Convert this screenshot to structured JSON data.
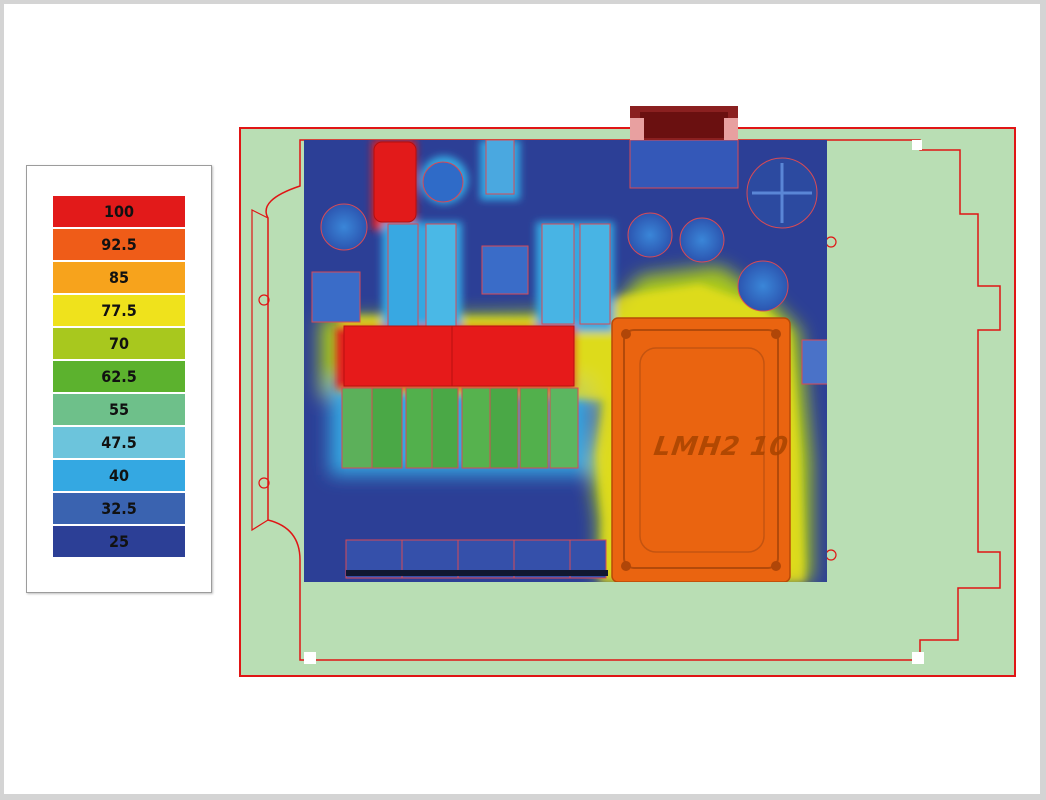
{
  "legend": {
    "entries": [
      {
        "label": "100",
        "color": "#e21a1a"
      },
      {
        "label": "92.5",
        "color": "#ef5c18"
      },
      {
        "label": "85",
        "color": "#f7a31c"
      },
      {
        "label": "77.5",
        "color": "#efe21c"
      },
      {
        "label": "70",
        "color": "#a8c81e"
      },
      {
        "label": "62.5",
        "color": "#5cb22e"
      },
      {
        "label": "55",
        "color": "#6ec08a"
      },
      {
        "label": "47.5",
        "color": "#6cc4dc"
      },
      {
        "label": "40",
        "color": "#34a8e2"
      },
      {
        "label": "32.5",
        "color": "#3a63b0"
      },
      {
        "label": "25",
        "color": "#2c3f96"
      }
    ]
  },
  "diagram": {
    "part_marking": "LMH2 10",
    "board_color": "#b8ddb4",
    "outline_color": "#e01515",
    "background_color": "#2c3f96"
  }
}
